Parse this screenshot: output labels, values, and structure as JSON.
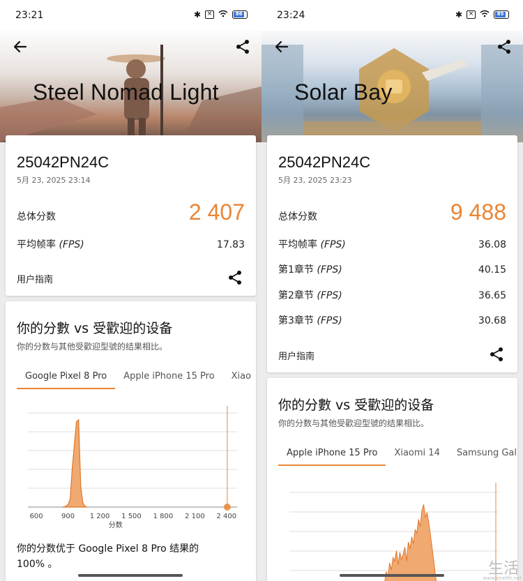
{
  "colors": {
    "accent": "#ea8534",
    "bar_fill": "#f0a970",
    "bar_stroke": "#e0762b"
  },
  "left": {
    "status": {
      "time": "23:21",
      "battery": "86",
      "battery_level": 0.86
    },
    "hero": {
      "title": "Steel Nomad Light"
    },
    "result": {
      "device": "25042PN24C",
      "date": "5月 23, 2025 23:14",
      "overall_label": "总体分数",
      "overall_score": "2 407",
      "fps_label": "平均帧率",
      "fps_unit": "(FPS)",
      "fps_value": "17.83",
      "guide": "用户指南"
    },
    "compare": {
      "title": "你的分數 vs 受歡迎的设备",
      "subtitle": "你的分数与其他受歡迎型號的结果相比。",
      "tabs": [
        "Google Pixel 8 Pro",
        "Apple iPhone 15 Pro",
        "Xiao"
      ],
      "verdict": "你的分数优于 Google Pixel 8 Pro 结果的 100% 。"
    },
    "chart_data": {
      "type": "area",
      "xlabel": "分数",
      "x_ticks": [
        "600",
        "900",
        "1 200",
        "1 500",
        "1 800",
        "2 100",
        "2 400"
      ],
      "x_tick_values": [
        600,
        900,
        1200,
        1500,
        1800,
        2100,
        2400
      ],
      "xlim": [
        520,
        2500
      ],
      "your_score": 2407,
      "series": [
        {
          "x": [
            850,
            880,
            900,
            920,
            940,
            960,
            980,
            1000,
            1020,
            1040,
            1060,
            1080
          ],
          "y": [
            0,
            0.01,
            0.03,
            0.09,
            0.45,
            0.72,
            0.98,
            1.0,
            0.24,
            0.05,
            0.01,
            0
          ]
        }
      ]
    }
  },
  "right": {
    "status": {
      "time": "23:24",
      "battery": "85",
      "battery_level": 0.85
    },
    "hero": {
      "title": "Solar Bay"
    },
    "result": {
      "device": "25042PN24C",
      "date": "5月 23, 2025 23:23",
      "overall_label": "总体分数",
      "overall_score": "9 488",
      "fps_label": "平均帧率",
      "fps_unit": "(FPS)",
      "fps_value": "36.08",
      "ch1_label": "第1章节",
      "ch1_value": "40.15",
      "ch2_label": "第2章节",
      "ch2_value": "36.65",
      "ch3_label": "第3章节",
      "ch3_value": "30.68",
      "guide": "用户指南"
    },
    "compare": {
      "title": "你的分數 vs 受歡迎的设备",
      "subtitle": "你的分数与其他受歡迎型號的结果相比。",
      "tabs": [
        "Apple iPhone 15 Pro",
        "Xiaomi 14",
        "Samsung Gal"
      ]
    },
    "chart_data": {
      "type": "area",
      "series": [
        {
          "y": [
            0,
            0.05,
            0.18,
            0.12,
            0.28,
            0.2,
            0.34,
            0.3,
            0.42,
            0.26,
            0.4,
            0.32,
            0.38,
            0.46,
            0.3,
            0.52,
            0.44,
            0.58,
            0.5,
            0.66,
            0.62,
            0.78,
            0.7,
            0.88,
            0.95,
            0.8,
            0.86,
            0.74,
            0.6,
            0.45,
            0.3,
            0.12,
            0.02
          ]
        }
      ]
    }
  },
  "watermark": {
    "text": "生活",
    "url": "www.zealife.net"
  }
}
